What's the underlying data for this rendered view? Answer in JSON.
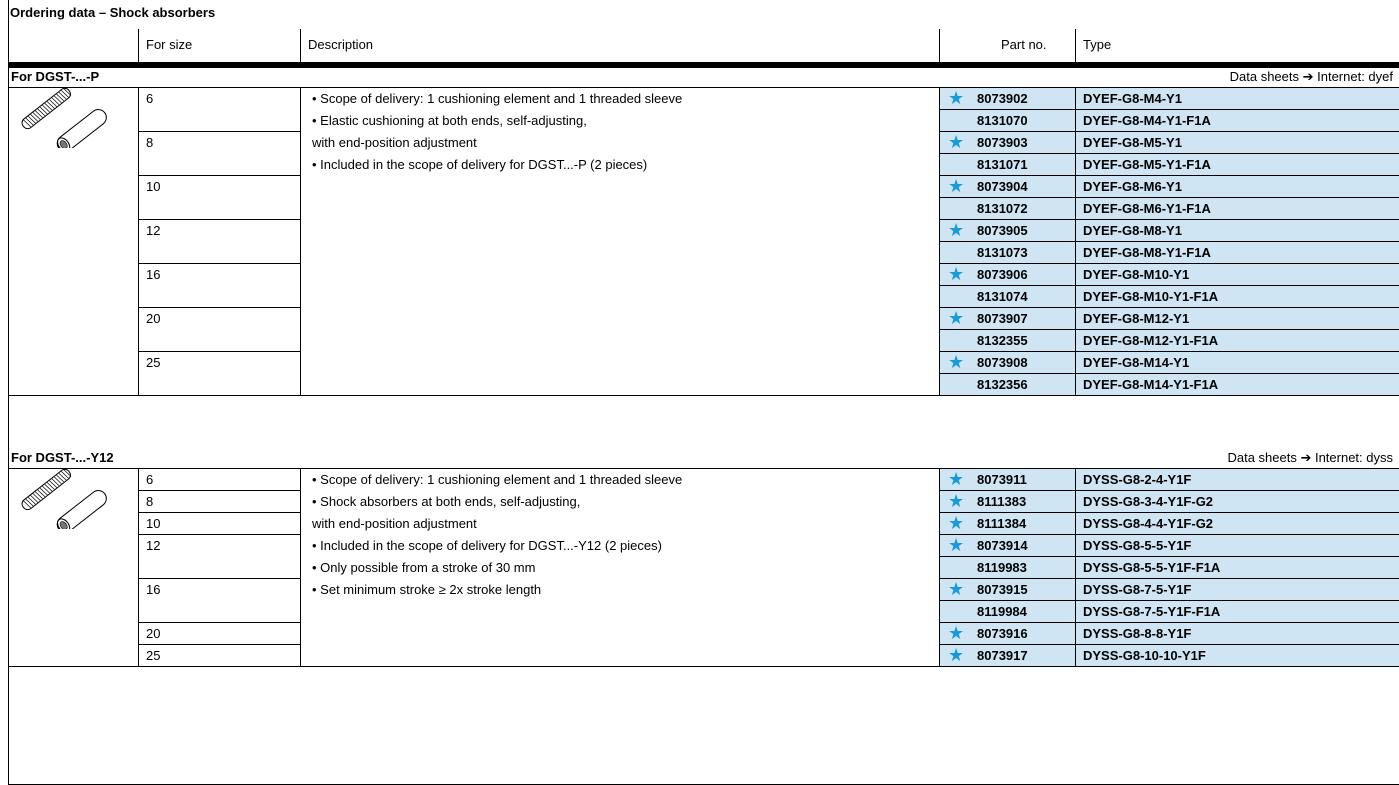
{
  "title": "Ordering data – Shock absorbers",
  "columns": {
    "size": "For size",
    "description": "Description",
    "part_no": "Part no.",
    "type": "Type"
  },
  "sections": [
    {
      "title": "For DGST-...-P",
      "datasheet": "Data sheets ➔ Internet: dyef",
      "image_icon": "threaded-shock-absorber-pair-icon",
      "description": [
        "• Scope of delivery: 1 cushioning element and 1 threaded sleeve",
        "• Elastic cushioning at both ends, self-adjusting,",
        "   with end-position adjustment",
        "• Included in the scope of delivery for DGST...-P (2 pieces)"
      ],
      "rows": [
        {
          "size": "6",
          "part": "8073902",
          "type": "DYEF-G8-M4-Y1",
          "star": true
        },
        {
          "size": "",
          "part": "8131070",
          "type": "DYEF-G8-M4-Y1-F1A",
          "star": false
        },
        {
          "size": "8",
          "part": "8073903",
          "type": "DYEF-G8-M5-Y1",
          "star": true
        },
        {
          "size": "",
          "part": "8131071",
          "type": "DYEF-G8-M5-Y1-F1A",
          "star": false
        },
        {
          "size": "10",
          "part": "8073904",
          "type": "DYEF-G8-M6-Y1",
          "star": true
        },
        {
          "size": "",
          "part": "8131072",
          "type": "DYEF-G8-M6-Y1-F1A",
          "star": false
        },
        {
          "size": "12",
          "part": "8073905",
          "type": "DYEF-G8-M8-Y1",
          "star": true
        },
        {
          "size": "",
          "part": "8131073",
          "type": "DYEF-G8-M8-Y1-F1A",
          "star": false
        },
        {
          "size": "16",
          "part": "8073906",
          "type": "DYEF-G8-M10-Y1",
          "star": true
        },
        {
          "size": "",
          "part": "8131074",
          "type": "DYEF-G8-M10-Y1-F1A",
          "star": false
        },
        {
          "size": "20",
          "part": "8073907",
          "type": "DYEF-G8-M12-Y1",
          "star": true
        },
        {
          "size": "",
          "part": "8132355",
          "type": "DYEF-G8-M12-Y1-F1A",
          "star": false
        },
        {
          "size": "25",
          "part": "8073908",
          "type": "DYEF-G8-M14-Y1",
          "star": true
        },
        {
          "size": "",
          "part": "8132356",
          "type": "DYEF-G8-M14-Y1-F1A",
          "star": false
        }
      ]
    },
    {
      "title": "For DGST-...-Y12",
      "datasheet": "Data sheets ➔ Internet: dyss",
      "image_icon": "threaded-shock-absorber-pair-icon",
      "description": [
        "• Scope of delivery: 1 cushioning element and 1 threaded sleeve",
        "• Shock absorbers at both ends, self-adjusting,",
        "   with end-position adjustment",
        "• Included in the scope of delivery for DGST...-Y12 (2 pieces)",
        "• Only possible from a stroke of 30 mm",
        "• Set minimum stroke ≥ 2x stroke length"
      ],
      "rows": [
        {
          "size": "6",
          "part": "8073911",
          "type": "DYSS-G8-2-4-Y1F",
          "star": true
        },
        {
          "size": "8",
          "part": "8111383",
          "type": "DYSS-G8-3-4-Y1F-G2",
          "star": true
        },
        {
          "size": "10",
          "part": "8111384",
          "type": "DYSS-G8-4-4-Y1F-G2",
          "star": true
        },
        {
          "size": "12",
          "part": "8073914",
          "type": "DYSS-G8-5-5-Y1F",
          "star": true
        },
        {
          "size": "",
          "part": "8119983",
          "type": "DYSS-G8-5-5-Y1F-F1A",
          "star": false
        },
        {
          "size": "16",
          "part": "8073915",
          "type": "DYSS-G8-7-5-Y1F",
          "star": true
        },
        {
          "size": "",
          "part": "8119984",
          "type": "DYSS-G8-7-5-Y1F-F1A",
          "star": false
        },
        {
          "size": "20",
          "part": "8073916",
          "type": "DYSS-G8-8-8-Y1F",
          "star": true
        },
        {
          "size": "25",
          "part": "8073917",
          "type": "DYSS-G8-10-10-Y1F",
          "star": true
        }
      ]
    }
  ],
  "colors": {
    "star": "#1a9ad8",
    "highlight": "#cfe5f4"
  }
}
